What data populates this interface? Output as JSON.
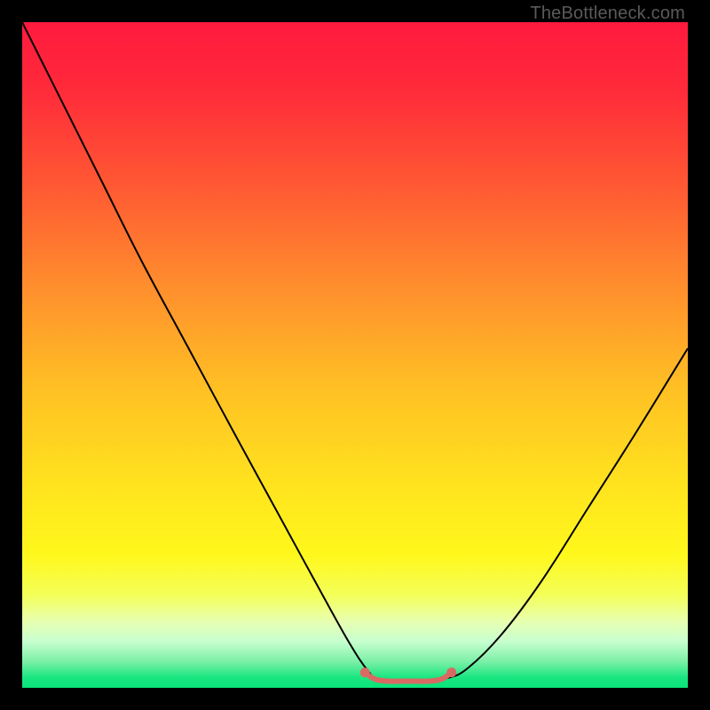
{
  "watermark": "TheBottleneck.com",
  "chart_data": {
    "type": "line",
    "title": "",
    "xlabel": "",
    "ylabel": "",
    "xlim": [
      0,
      100
    ],
    "ylim": [
      0,
      100
    ],
    "grid": false,
    "legend": false,
    "gradient_stops": [
      {
        "offset": 0.0,
        "color": "#ff1a3e"
      },
      {
        "offset": 0.1,
        "color": "#ff2a3a"
      },
      {
        "offset": 0.25,
        "color": "#ff5a33"
      },
      {
        "offset": 0.4,
        "color": "#ff8f2d"
      },
      {
        "offset": 0.55,
        "color": "#ffc024"
      },
      {
        "offset": 0.7,
        "color": "#ffe41e"
      },
      {
        "offset": 0.8,
        "color": "#fff81c"
      },
      {
        "offset": 0.86,
        "color": "#f4ff58"
      },
      {
        "offset": 0.9,
        "color": "#e8ffb0"
      },
      {
        "offset": 0.93,
        "color": "#c8ffd0"
      },
      {
        "offset": 0.96,
        "color": "#7df0a8"
      },
      {
        "offset": 0.985,
        "color": "#18e680"
      },
      {
        "offset": 1.0,
        "color": "#0ae37a"
      }
    ],
    "series": [
      {
        "name": "curve",
        "x": [
          0.0,
          3.0,
          7.0,
          12.0,
          18.0,
          25.0,
          32.0,
          38.0,
          44.0,
          49.0,
          52.0,
          54.0,
          60.0,
          64.0,
          67.0,
          72.0,
          78.0,
          85.0,
          92.0,
          100.0
        ],
        "y": [
          100.0,
          94.0,
          86.0,
          76.0,
          64.0,
          51.0,
          38.0,
          27.0,
          16.0,
          7.0,
          2.5,
          1.0,
          1.0,
          1.5,
          3.0,
          8.0,
          16.0,
          27.0,
          38.0,
          51.0
        ],
        "stroke": "#000000",
        "stroke_width": 2
      }
    ],
    "flat_segment": {
      "x": [
        51.5,
        53.0,
        55.0,
        57.0,
        59.0,
        61.0,
        63.0,
        64.5
      ],
      "y": [
        2.3,
        1.3,
        1.0,
        1.0,
        1.0,
        1.0,
        1.3,
        2.3
      ],
      "stroke": "#d96a63",
      "stroke_width": 6,
      "point_radius": 5.5
    }
  }
}
